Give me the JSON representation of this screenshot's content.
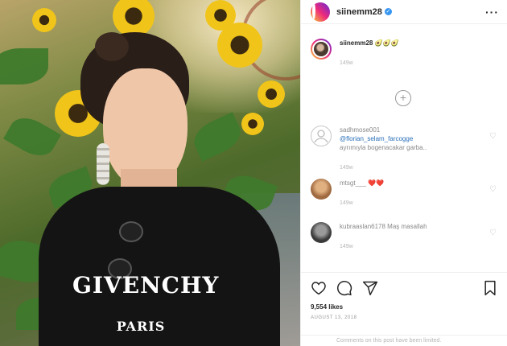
{
  "post": {
    "username": "siinemm28",
    "verified_icon": "verified-badge-icon",
    "more_icon": "more-options-icon"
  },
  "caption": {
    "username": "siinemm28",
    "text": "🥑🥑🥑",
    "time": "149w"
  },
  "load_more_icon": "plus-circle-icon",
  "comments": [
    {
      "username": "sadhmose001",
      "mention": "@florian_selam_farcogge",
      "text": "ayrımıyla bogenacakar garba..",
      "time": "149w"
    },
    {
      "username": "mtsgt___",
      "text": "❤️❤️",
      "time": "149w"
    },
    {
      "username": "kubraaslan6178",
      "text": "Maş masallah",
      "time": "149w"
    }
  ],
  "actions": {
    "icons": [
      "heart-icon",
      "comment-icon",
      "share-icon",
      "bookmark-icon"
    ],
    "likes": "9,554 likes",
    "date": "AUGUST 13, 2018"
  },
  "footer": {
    "text": "Comments on this post have been limited."
  },
  "photo": {
    "brand": "GIVENCHY",
    "city": "PARIS"
  }
}
